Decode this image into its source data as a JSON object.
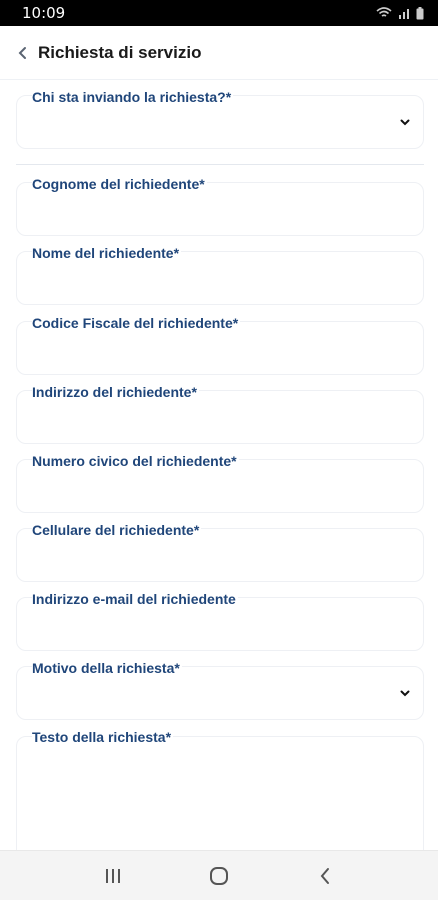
{
  "status_bar": {
    "time": "10:09"
  },
  "app_bar": {
    "title": "Richiesta di servizio"
  },
  "form": {
    "fields": [
      {
        "label": "Chi sta inviando la richiesta?*",
        "value": ""
      },
      {
        "label": "Cognome del richiedente*",
        "value": ""
      },
      {
        "label": "Nome del richiedente*",
        "value": ""
      },
      {
        "label": "Codice Fiscale del richiedente*",
        "value": ""
      },
      {
        "label": "Indirizzo del richiedente*",
        "value": ""
      },
      {
        "label": "Numero civico del richiedente*",
        "value": ""
      },
      {
        "label": "Cellulare del richiedente*",
        "value": ""
      },
      {
        "label": "Indirizzo e-mail del richiedente",
        "value": ""
      },
      {
        "label": "Motivo della richiesta*",
        "value": ""
      },
      {
        "label": "Testo della richiesta*",
        "value": ""
      }
    ]
  },
  "colors": {
    "label": "#20467a",
    "border": "#eef0f4",
    "title": "#1a1a1a"
  },
  "icons": {
    "back": "chevron-left-icon",
    "dropdown": "chevron-down-icon"
  }
}
